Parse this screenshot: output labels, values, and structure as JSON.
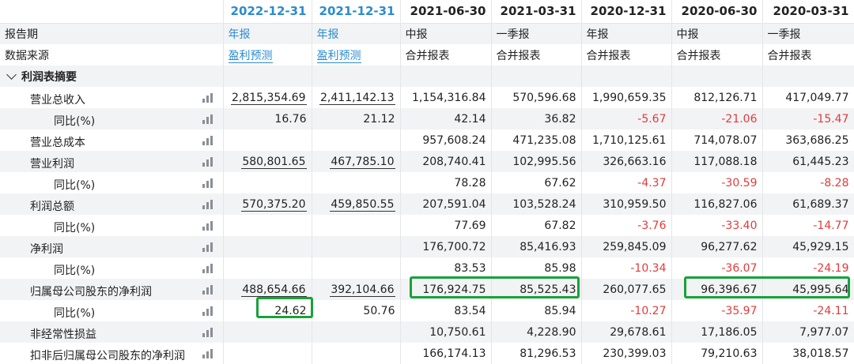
{
  "columns": [
    "2022-12-31",
    "2021-12-31",
    "2021-06-30",
    "2021-03-31",
    "2020-12-31",
    "2020-06-30",
    "2020-03-31"
  ],
  "report_period": {
    "label": "报告期",
    "values": [
      "年报",
      "年报",
      "中报",
      "一季报",
      "年报",
      "中报",
      "一季报"
    ]
  },
  "data_source": {
    "label": "数据来源",
    "values": [
      "盈利预测",
      "盈利预测",
      "合并报表",
      "合并报表",
      "合并报表",
      "合并报表",
      "合并报表"
    ]
  },
  "section": {
    "label": "利润表摘要"
  },
  "rows": [
    {
      "label": "营业总收入",
      "level": 1,
      "values": [
        "2,815,354.69",
        "2,411,142.13",
        "1,154,316.84",
        "570,596.68",
        "1,990,659.35",
        "812,126.71",
        "417,049.77"
      ]
    },
    {
      "label": "同比(%)",
      "level": 2,
      "values": [
        "16.76",
        "21.12",
        "42.14",
        "36.82",
        "-5.67",
        "-21.06",
        "-15.47"
      ]
    },
    {
      "label": "营业总成本",
      "level": 1,
      "values": [
        "",
        "",
        "957,608.24",
        "471,235.08",
        "1,710,125.61",
        "714,078.07",
        "363,686.25"
      ]
    },
    {
      "label": "营业利润",
      "level": 1,
      "values": [
        "580,801.65",
        "467,785.10",
        "208,740.41",
        "102,995.56",
        "326,663.16",
        "117,088.18",
        "61,445.23"
      ]
    },
    {
      "label": "同比(%)",
      "level": 2,
      "values": [
        "",
        "",
        "78.28",
        "67.62",
        "-4.37",
        "-30.59",
        "-8.28"
      ]
    },
    {
      "label": "利润总额",
      "level": 1,
      "values": [
        "570,375.20",
        "459,850.55",
        "207,591.04",
        "103,528.24",
        "310,959.50",
        "116,827.06",
        "61,689.37"
      ]
    },
    {
      "label": "同比(%)",
      "level": 2,
      "values": [
        "",
        "",
        "77.69",
        "67.82",
        "-3.76",
        "-33.40",
        "-14.77"
      ]
    },
    {
      "label": "净利润",
      "level": 1,
      "values": [
        "",
        "",
        "176,700.72",
        "85,416.93",
        "259,845.09",
        "96,277.62",
        "45,929.15"
      ]
    },
    {
      "label": "同比(%)",
      "level": 2,
      "values": [
        "",
        "",
        "83.53",
        "85.98",
        "-10.34",
        "-36.07",
        "-24.19"
      ]
    },
    {
      "label": "归属母公司股东的净利润",
      "level": 1,
      "values": [
        "488,654.66",
        "392,104.66",
        "176,924.75",
        "85,525.43",
        "260,077.65",
        "96,396.67",
        "45,995.64"
      ]
    },
    {
      "label": "同比(%)",
      "level": 2,
      "values": [
        "24.62",
        "50.76",
        "83.54",
        "85.94",
        "-10.27",
        "-35.97",
        "-24.11"
      ]
    },
    {
      "label": "非经常性损益",
      "level": 1,
      "values": [
        "",
        "",
        "10,750.61",
        "4,228.90",
        "29,678.61",
        "17,186.05",
        "7,977.07"
      ]
    },
    {
      "label": "扣非后归属母公司股东的净利润",
      "level": 1,
      "values": [
        "",
        "",
        "166,174.13",
        "81,296.53",
        "230,399.03",
        "79,210.63",
        "38,018.57"
      ]
    }
  ],
  "colors": {
    "forecast": "#2a8bd0",
    "negative": "#e23b3b",
    "highlight": "#18a23a",
    "alt_row": "#f2f3f5"
  },
  "icon_names": {
    "chart": "bar-chart-icon",
    "expand": "chevron-down-icon"
  }
}
